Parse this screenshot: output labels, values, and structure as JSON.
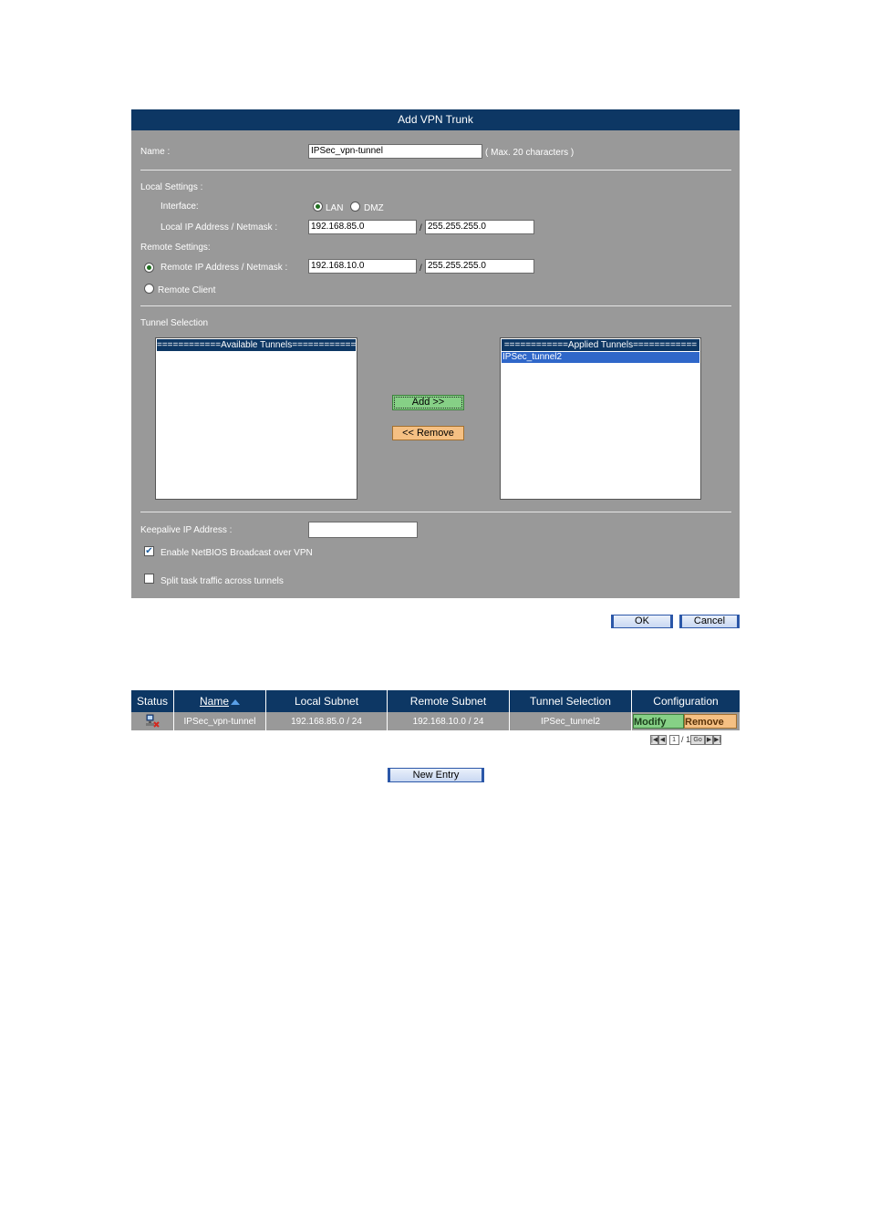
{
  "form": {
    "title": "Add VPN Trunk",
    "name_label": "Name :",
    "name_value": "IPSec_vpn-tunnel",
    "name_hint": "( Max. 20 characters )",
    "local_settings_label": "Local Settings :",
    "interface_label": "Interface:",
    "interface_options": [
      "LAN",
      "DMZ"
    ],
    "interface_selected": "LAN",
    "local_ip_label": "Local IP Address / Netmask :",
    "local_ip": "192.168.85.0",
    "local_mask": "255.255.255.0",
    "remote_settings_label": "Remote Settings:",
    "remote_ip_label": "Remote IP Address / Netmask :",
    "remote_ip": "192.168.10.0",
    "remote_mask": "255.255.255.0",
    "remote_client_label": "Remote Client",
    "slash": "/",
    "tunnel_selection_label": "Tunnel Selection",
    "available_header": "============Available Tunnels============",
    "applied_header": "============Applied Tunnels============",
    "applied_items": [
      "IPSec_tunnel2"
    ],
    "add_button": "Add >>",
    "remove_button": "<< Remove",
    "keepalive_label": "Keepalive IP Address :",
    "keepalive_value": "",
    "netbios_label": "Enable NetBIOS Broadcast over VPN",
    "netbios_checked": true,
    "split_label": "Split task traffic across tunnels",
    "split_checked": false
  },
  "actions": {
    "ok": "OK",
    "cancel": "Cancel",
    "new_entry": "New Entry"
  },
  "table": {
    "headers": [
      "Status",
      "Name",
      "Local Subnet",
      "Remote Subnet",
      "Tunnel Selection",
      "Configuration"
    ],
    "rows": [
      {
        "status_icon": "network-disconnected-icon",
        "name": "IPSec_vpn-tunnel",
        "local_subnet": "192.168.85.0 / 24",
        "remote_subnet": "192.168.10.0 / 24",
        "tunnel_selection": "IPSec_tunnel2",
        "modify": "Modify",
        "remove": "Remove"
      }
    ]
  },
  "pagination": {
    "current_page": "1",
    "separator": "/",
    "total_pages": "1",
    "go": "Go"
  },
  "colors": {
    "header_bg": "#0d3764",
    "panel_bg": "#999999",
    "add_green": "#86d086",
    "remove_orange": "#f5c083"
  }
}
